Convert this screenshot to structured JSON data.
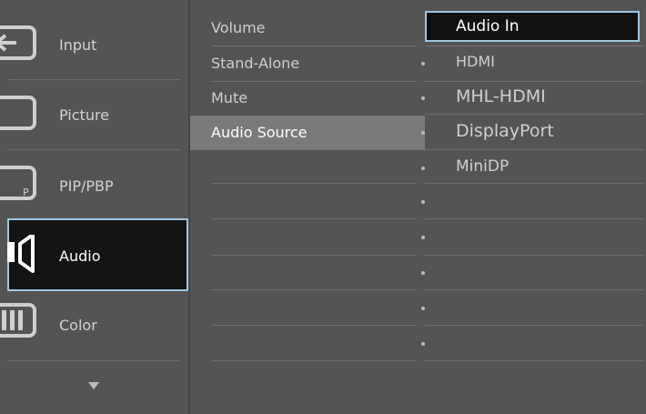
{
  "categories": [
    {
      "label": "Input",
      "icon": "input-icon"
    },
    {
      "label": "Picture",
      "icon": "picture-icon"
    },
    {
      "label": "PIP/PBP",
      "icon": "pip-pbp-icon",
      "icon_text": "P"
    },
    {
      "label": "Audio",
      "icon": "audio-icon"
    },
    {
      "label": "Color",
      "icon": "color-icon"
    }
  ],
  "submenu": [
    {
      "label": "Volume"
    },
    {
      "label": "Stand-Alone"
    },
    {
      "label": "Mute"
    },
    {
      "label": "Audio Source"
    }
  ],
  "options": [
    {
      "label": "Audio In"
    },
    {
      "label": "HDMI"
    },
    {
      "label": "MHL-HDMI"
    },
    {
      "label": "DisplayPort"
    },
    {
      "label": "MiniDP"
    }
  ],
  "selected_category": "Audio",
  "highlighted_submenu": "Audio Source",
  "selected_option": "Audio In",
  "colors": {
    "background": "#545454",
    "selection_border": "#9fc7e3",
    "selection_fill": "#141414",
    "highlight": "#7a7a7a"
  }
}
